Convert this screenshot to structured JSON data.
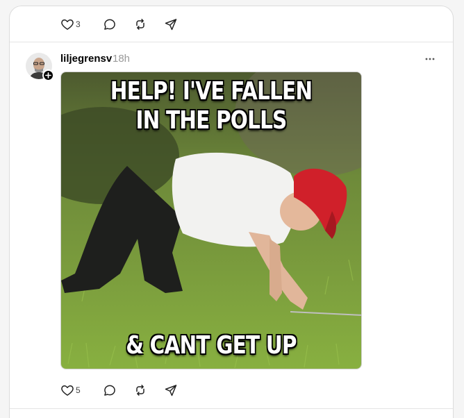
{
  "previous_post": {
    "like_count": "3"
  },
  "post": {
    "username": "liljegrensv",
    "time": "18h",
    "image_caption_top": "HELP! I'VE FALLEN IN THE POLLS",
    "image_caption_top_line1": "HELP! I'VE FALLEN",
    "image_caption_top_line2": "IN THE POLLS",
    "image_caption_bottom": "& CANT GET UP",
    "like_count": "5"
  },
  "icons": {
    "like": "heart-icon",
    "reply": "comment-icon",
    "repost": "repost-icon",
    "share": "send-icon",
    "more": "more-icon",
    "follow": "plus-icon"
  },
  "colors": {
    "text": "#000000",
    "muted": "#9a9a9a",
    "border": "#dcdcdc",
    "hat_red": "#d0202a",
    "grass": "#5c8a2a"
  }
}
